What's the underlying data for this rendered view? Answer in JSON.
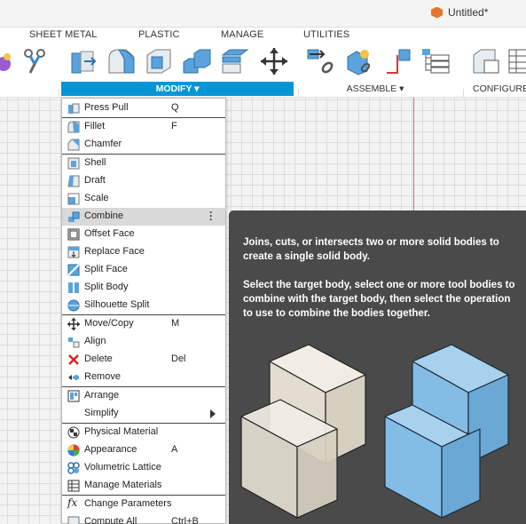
{
  "window": {
    "title": "Untitled*"
  },
  "tabs": [
    "SHEET METAL",
    "PLASTIC",
    "MANAGE",
    "UTILITIES"
  ],
  "toolbar": {
    "modify_label": "MODIFY ▾",
    "assemble_label": "ASSEMBLE ▾",
    "configure_label": "CONFIGURE"
  },
  "menu": {
    "items": [
      {
        "label": "Press Pull",
        "shortcut": "Q",
        "icon": "press-pull-icon"
      },
      {
        "label": "Fillet",
        "shortcut": "F",
        "icon": "fillet-icon"
      },
      {
        "label": "Chamfer",
        "shortcut": "",
        "icon": "chamfer-icon"
      },
      {
        "label": "Shell",
        "shortcut": "",
        "icon": "shell-icon"
      },
      {
        "label": "Draft",
        "shortcut": "",
        "icon": "draft-icon"
      },
      {
        "label": "Scale",
        "shortcut": "",
        "icon": "scale-icon"
      },
      {
        "label": "Combine",
        "shortcut": "",
        "icon": "combine-icon"
      },
      {
        "label": "Offset Face",
        "shortcut": "",
        "icon": "offset-face-icon"
      },
      {
        "label": "Replace Face",
        "shortcut": "",
        "icon": "replace-face-icon"
      },
      {
        "label": "Split Face",
        "shortcut": "",
        "icon": "split-face-icon"
      },
      {
        "label": "Split Body",
        "shortcut": "",
        "icon": "split-body-icon"
      },
      {
        "label": "Silhouette Split",
        "shortcut": "",
        "icon": "silhouette-split-icon"
      },
      {
        "label": "Move/Copy",
        "shortcut": "M",
        "icon": "move-icon"
      },
      {
        "label": "Align",
        "shortcut": "",
        "icon": "align-icon"
      },
      {
        "label": "Delete",
        "shortcut": "Del",
        "icon": "delete-icon"
      },
      {
        "label": "Remove",
        "shortcut": "",
        "icon": "remove-icon"
      },
      {
        "label": "Arrange",
        "shortcut": "",
        "icon": "arrange-icon"
      },
      {
        "label": "Simplify",
        "shortcut": "",
        "icon": "simplify-icon"
      },
      {
        "label": "Physical Material",
        "shortcut": "",
        "icon": "physical-material-icon"
      },
      {
        "label": "Appearance",
        "shortcut": "A",
        "icon": "appearance-icon"
      },
      {
        "label": "Volumetric Lattice",
        "shortcut": "",
        "icon": "volumetric-lattice-icon"
      },
      {
        "label": "Manage Materials",
        "shortcut": "",
        "icon": "manage-materials-icon"
      },
      {
        "label": "Change Parameters",
        "shortcut": "",
        "icon": "change-parameters-icon"
      },
      {
        "label": "Compute All",
        "shortcut": "Ctrl+B",
        "icon": "compute-all-icon"
      }
    ]
  },
  "tooltip": {
    "line1": "Joins, cuts, or intersects two or more solid bodies to create a single solid body.",
    "line2": "Select the target body, select one or more tool bodies to combine with the target body, then select the operation to use to combine the bodies together."
  },
  "colors": {
    "accent": "#0696d7",
    "highlight": "#d9d9d9",
    "tooltip_bg": "#4a4a4a",
    "cube_blue": "#7ab8e0",
    "cube_beige": "#e6e1d5"
  }
}
